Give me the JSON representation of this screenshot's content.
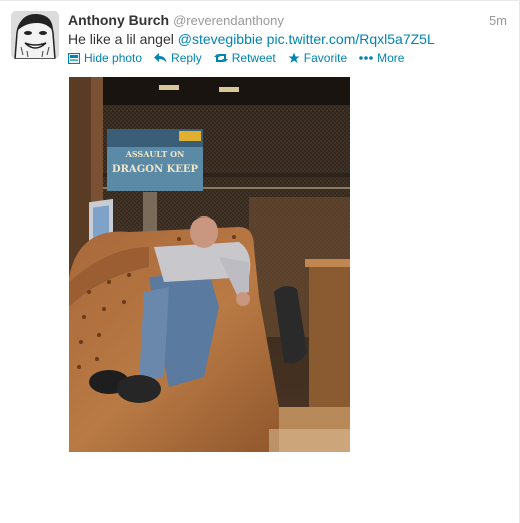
{
  "tweet": {
    "display_name": "Anthony Burch",
    "handle": "@reverendanthony",
    "timestamp": "5m",
    "text_prefix": "He like a lil angel ",
    "mention": "@stevegibbie",
    "photo_link": "pic.twitter.com/Rqxl5a7Z5L",
    "photo_sign_text": "ASSAULT ON DRAGON KEEP"
  },
  "actions": {
    "hide_photo": "Hide photo",
    "reply": "Reply",
    "retweet": "Retweet",
    "favorite": "Favorite",
    "more": "More"
  },
  "colors": {
    "link": "#0084b4",
    "name": "#333333",
    "muted": "#999999"
  },
  "icons": {
    "hide_photo": "photo-icon",
    "reply": "reply-arrow-icon",
    "retweet": "retweet-icon",
    "favorite": "star-icon",
    "more": "ellipsis-icon"
  }
}
